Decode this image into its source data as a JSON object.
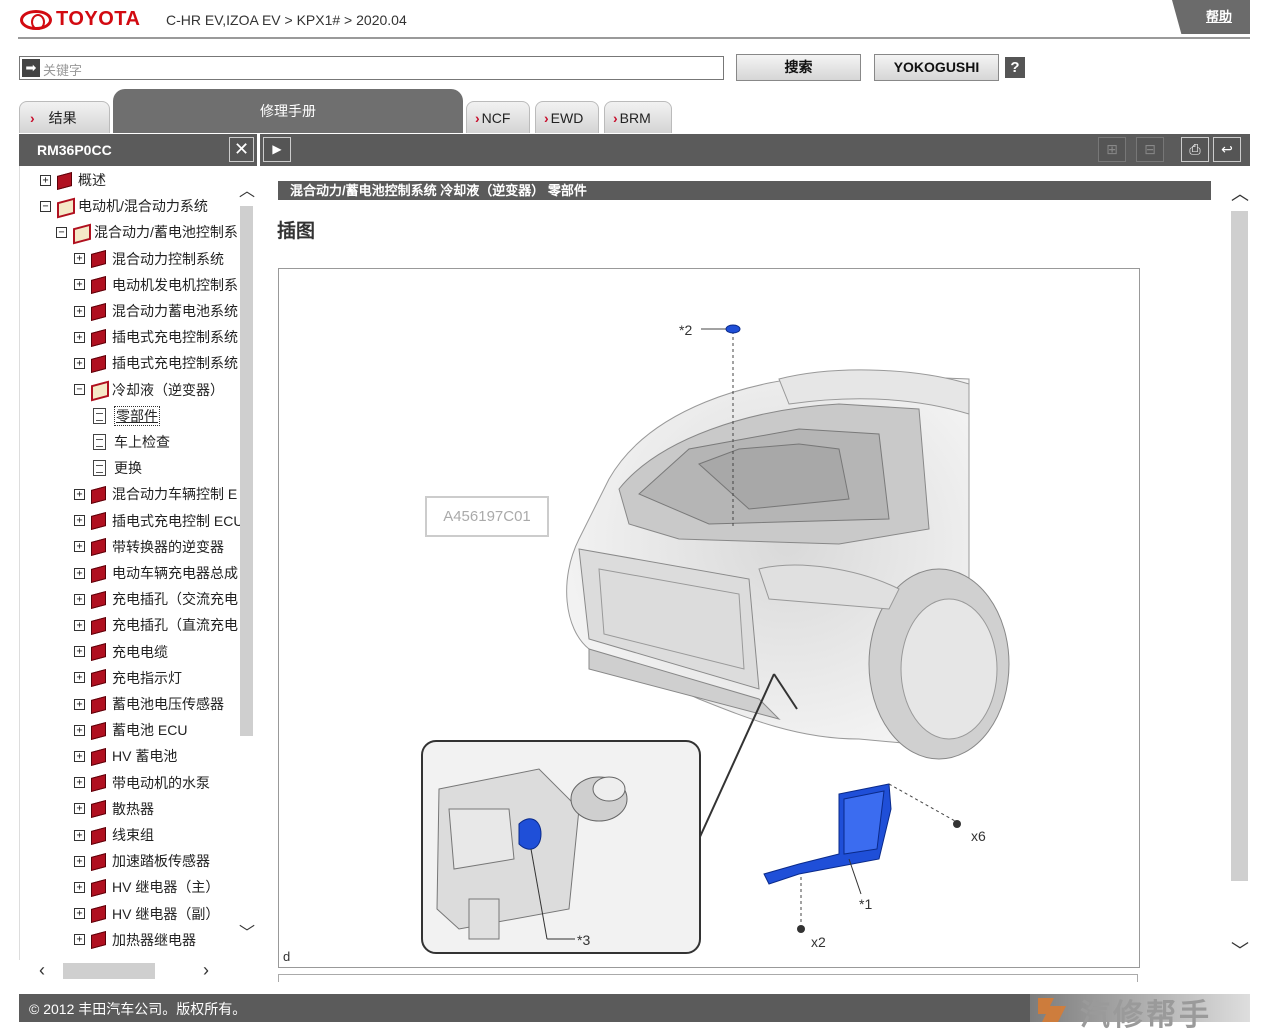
{
  "header": {
    "logo_text": "TOYOTA",
    "breadcrumb": "C-HR EV,IZOA EV > KPX1# > 2020.04",
    "help_label": "帮助"
  },
  "search": {
    "placeholder": "关键字",
    "search_label": "搜索",
    "yokogushi_label": "YOKOGUSHI",
    "help_icon": "?"
  },
  "tabs": {
    "result": "结果",
    "manual": "修理手册",
    "ncf": "NCF",
    "ewd": "EWD",
    "brm": "BRM"
  },
  "left_toolbar": {
    "doc_code": "RM36P0CC"
  },
  "tree": [
    {
      "label": "概述",
      "level": 0,
      "icon": "book-closed"
    },
    {
      "label": "电动机/混合动力系统",
      "level": 0,
      "icon": "book-open"
    },
    {
      "label": "混合动力/蓄电池控制系",
      "level": 1,
      "icon": "book-open"
    },
    {
      "label": "混合动力控制系统",
      "level": 2,
      "icon": "book-closed"
    },
    {
      "label": "电动机发电机控制系",
      "level": 2,
      "icon": "book-closed"
    },
    {
      "label": "混合动力蓄电池系统",
      "level": 2,
      "icon": "book-closed"
    },
    {
      "label": "插电式充电控制系统",
      "level": 2,
      "icon": "book-closed"
    },
    {
      "label": "插电式充电控制系统",
      "level": 2,
      "icon": "book-closed"
    },
    {
      "label": "冷却液（逆变器）",
      "level": 2,
      "icon": "book-open"
    },
    {
      "label": "零部件",
      "level": 3,
      "icon": "page",
      "selected": true
    },
    {
      "label": "车上检查",
      "level": 3,
      "icon": "page"
    },
    {
      "label": "更换",
      "level": 3,
      "icon": "page"
    },
    {
      "label": "混合动力车辆控制 E",
      "level": 2,
      "icon": "book-closed"
    },
    {
      "label": "插电式充电控制 ECU",
      "level": 2,
      "icon": "book-closed"
    },
    {
      "label": "带转换器的逆变器",
      "level": 2,
      "icon": "book-closed"
    },
    {
      "label": "电动车辆充电器总成",
      "level": 2,
      "icon": "book-closed"
    },
    {
      "label": "充电插孔（交流充电",
      "level": 2,
      "icon": "book-closed"
    },
    {
      "label": "充电插孔（直流充电",
      "level": 2,
      "icon": "book-closed"
    },
    {
      "label": "充电电缆",
      "level": 2,
      "icon": "book-closed"
    },
    {
      "label": "充电指示灯",
      "level": 2,
      "icon": "book-closed"
    },
    {
      "label": "蓄电池电压传感器",
      "level": 2,
      "icon": "book-closed"
    },
    {
      "label": "蓄电池 ECU",
      "level": 2,
      "icon": "book-closed"
    },
    {
      "label": "HV 蓄电池",
      "level": 2,
      "icon": "book-closed"
    },
    {
      "label": "带电动机的水泵",
      "level": 2,
      "icon": "book-closed"
    },
    {
      "label": "散热器",
      "level": 2,
      "icon": "book-closed"
    },
    {
      "label": "线束组",
      "level": 2,
      "icon": "book-closed"
    },
    {
      "label": "加速踏板传感器",
      "level": 2,
      "icon": "book-closed"
    },
    {
      "label": "HV 继电器（主）",
      "level": 2,
      "icon": "book-closed"
    },
    {
      "label": "HV 继电器（副）",
      "level": 2,
      "icon": "book-closed"
    },
    {
      "label": "加热器继电器",
      "level": 2,
      "icon": "book-closed"
    }
  ],
  "content": {
    "bar_title": "混合动力/蓄电池控制系统  冷却液（逆变器）  零部件",
    "section_title": "插图",
    "figure_id": "A456197C01",
    "figure_corner": "d",
    "callouts": {
      "c1": "*1",
      "c2": "*2",
      "c3": "*3",
      "x6": "x6",
      "x2": "x2"
    }
  },
  "footer": {
    "copyright": "© 2012 丰田汽车公司。版权所有。",
    "watermark": "汽修帮手"
  },
  "colors": {
    "toyota_red": "#d20a11",
    "toolbar_gray": "#5b5b5b",
    "highlight_blue": "#1f4fd8"
  }
}
